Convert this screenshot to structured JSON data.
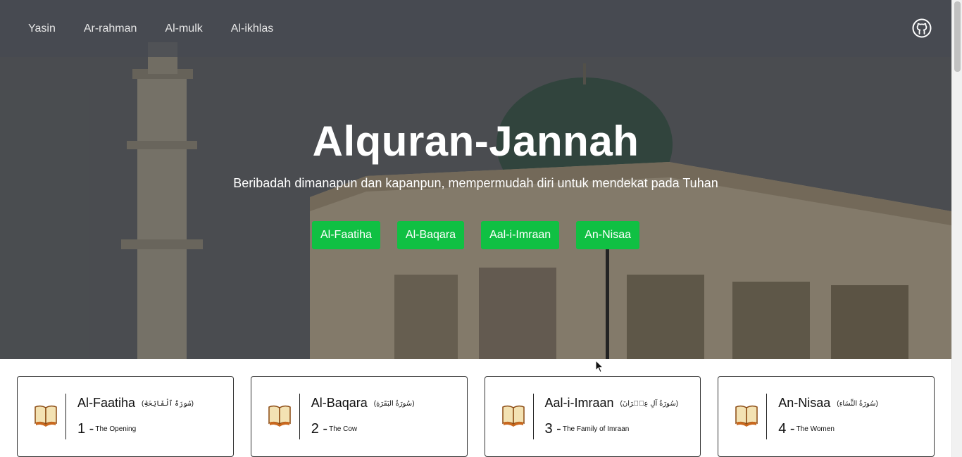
{
  "nav": {
    "links": [
      "Yasin",
      "Ar-rahman",
      "Al-mulk",
      "Al-ikhlas"
    ],
    "github_icon": "github-icon"
  },
  "hero": {
    "title": "Alquran-Jannah",
    "subtitle": "Beribadah dimanapun dan kapanpun, mempermudah diri untuk mendekat pada Tuhan",
    "buttons": [
      "Al-Faatiha",
      "Al-Baqara",
      "Aal-i-Imraan",
      "An-Nisaa"
    ],
    "button_color": "#10c043"
  },
  "cards": [
    {
      "name": "Al-Faatiha",
      "arabic": "(سُورَةُ ٱلْفَاتِحَةِ)",
      "number": "1 -",
      "english": "The Opening",
      "icon": "book-icon"
    },
    {
      "name": "Al-Baqara",
      "arabic": "(سُورَةُ البَقَرَةِ)",
      "number": "2 -",
      "english": "The Cow",
      "icon": "book-icon"
    },
    {
      "name": "Aal-i-Imraan",
      "arabic": "(سُورَةُ آلِ عِمۡرَانَ)",
      "number": "3 -",
      "english": "The Family of Imraan",
      "icon": "book-icon"
    },
    {
      "name": "An-Nisaa",
      "arabic": "(سُورَةُ النِّسَاءِ)",
      "number": "4 -",
      "english": "The Women",
      "icon": "book-icon"
    }
  ]
}
